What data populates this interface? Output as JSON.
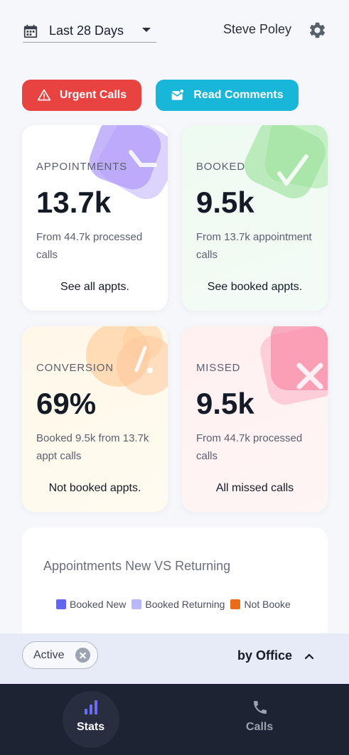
{
  "header": {
    "date_range": "Last 28 Days",
    "user_name": "Steve Poley"
  },
  "actions": {
    "urgent_label": "Urgent Calls",
    "comments_label": "Read Comments"
  },
  "cards": [
    {
      "label": "APPOINTMENTS",
      "value": "13.7k",
      "desc": "From 44.7k processed calls",
      "link": "See all appts."
    },
    {
      "label": "BOOKED",
      "value": "9.5k",
      "desc": "From 13.7k appointment calls",
      "link": "See booked appts."
    },
    {
      "label": "CONVERSION",
      "value": "69%",
      "desc": "Booked 9.5k from 13.7k appt calls",
      "link": "Not booked appts."
    },
    {
      "label": "MISSED",
      "value": "9.5k",
      "desc": "From 44.7k processed calls",
      "link": "All missed calls"
    }
  ],
  "chart": {
    "title": "Appointments New VS Returning",
    "legend": [
      {
        "name": "Booked New",
        "color": "#6366f1"
      },
      {
        "name": "Booked Returning",
        "color": "#b9b8fa"
      },
      {
        "name": "Not Booke",
        "color": "#ea6c15"
      }
    ]
  },
  "filter": {
    "chip_label": "Active",
    "group_label": "by Office"
  },
  "nav": {
    "stats_label": "Stats",
    "calls_label": "Calls"
  },
  "colors": {
    "urgent": "#e84340",
    "comments": "#18b6d8",
    "nav_bg": "#1e2333",
    "accent": "#6366f1"
  },
  "icons": [
    "calendar-icon",
    "gear-icon",
    "warning-icon",
    "mail-icon",
    "close-icon",
    "chevron-up-icon",
    "bar-chart-icon",
    "phone-icon"
  ]
}
